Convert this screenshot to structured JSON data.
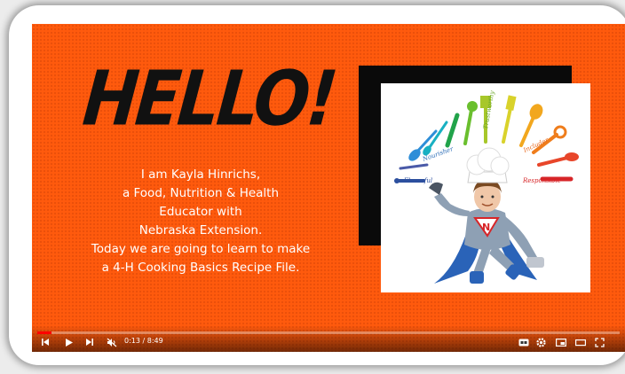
{
  "slide": {
    "heading": "HELLO!",
    "lines": [
      "I am Kayla Hinrichs,",
      "a Food, Nutrition & Health",
      "Educator with",
      "Nebraska Extension.",
      "Today we are going to learn to make",
      "a 4-H Cooking Basics Recipe File."
    ],
    "badge_letter": "N"
  },
  "illustration": {
    "words": [
      "Nourisher",
      "Trustworthy",
      "Includer",
      "Flavorful",
      "Responsible"
    ]
  },
  "player": {
    "current_time": "0:13",
    "separator": " / ",
    "duration": "8:49",
    "progress": 0.025,
    "icons": [
      "skip-back-icon",
      "play-icon",
      "skip-next-icon",
      "mute-icon",
      "captions-icon",
      "settings-icon",
      "miniplayer-icon",
      "theater-icon",
      "fullscreen-icon"
    ]
  },
  "colors": {
    "slide_background": "#ff5a0d",
    "progress": "#ff0000",
    "hero_suit": "#8ea0b4",
    "cape": "#2a63b8"
  }
}
